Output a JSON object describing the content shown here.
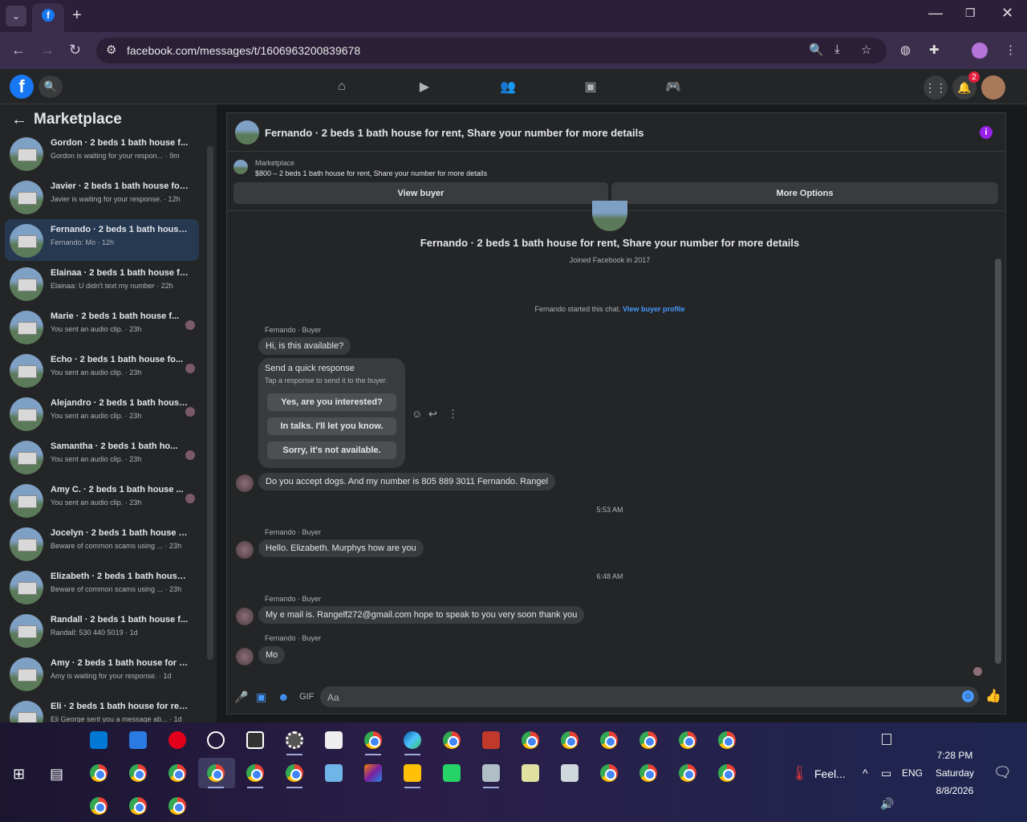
{
  "browser": {
    "url": "facebook.com/messages/t/1606963200839678",
    "new_tab": "+",
    "min": "—",
    "max": "❐",
    "close": "✕"
  },
  "fb": {
    "logo": "f",
    "notif_count": "2"
  },
  "sidebar": {
    "title": "Marketplace",
    "back": "←",
    "items": [
      {
        "title": "Gordon · 2 beds 1 bath house f...",
        "sub": "Gordon is waiting for your respon... · 9m",
        "selected": false
      },
      {
        "title": "Javier · 2 beds 1 bath house for ...",
        "sub": "Javier is waiting for your response. · 12h",
        "selected": false
      },
      {
        "title": "Fernando · 2 beds 1 bath house ...",
        "sub": "Fernando: Mo · 12h",
        "selected": true
      },
      {
        "title": "Elainaa · 2 beds 1 bath house fo...",
        "sub": "Elainaa: U didn't text my number · 22h",
        "selected": false
      },
      {
        "title": "Marie · 2 beds 1 bath house f...",
        "sub": "You sent an audio clip. · 23h",
        "selected": false
      },
      {
        "title": "Echo · 2 beds 1 bath house fo...",
        "sub": "You sent an audio clip. · 23h",
        "selected": false
      },
      {
        "title": "Alejandro · 2 beds 1 bath house...",
        "sub": "You sent an audio clip. · 23h",
        "selected": false
      },
      {
        "title": "Samantha · 2 beds 1 bath ho...",
        "sub": "You sent an audio clip. · 23h",
        "selected": false
      },
      {
        "title": "Amy C. · 2 beds 1 bath house ...",
        "sub": "You sent an audio clip. · 23h",
        "selected": false
      },
      {
        "title": "Jocelyn · 2 beds 1 bath house fo...",
        "sub": "Beware of common scams using ... · 23h",
        "selected": false
      },
      {
        "title": "Elizabeth · 2 beds 1 bath house ...",
        "sub": "Beware of common scams using ... · 23h",
        "selected": false
      },
      {
        "title": "Randall · 2 beds 1 bath house f...",
        "sub": "Randall: 530 440 5019 · 1d",
        "selected": false
      },
      {
        "title": "Amy · 2 beds 1 bath house for r...",
        "sub": "Amy is waiting for your response. · 1d",
        "selected": false
      },
      {
        "title": "Eli · 2 beds 1 bath house for ren...",
        "sub": "Eli George sent you a message ab... · 1d",
        "selected": false
      }
    ]
  },
  "chat": {
    "title": "Fernando · 2 beds 1 bath house for rent, Share your number for more details",
    "info": "i",
    "marketplace_label": "Marketplace",
    "listing": "$800 – 2 beds 1 bath house for rent, Share your number for more details",
    "view_buyer": "View buyer",
    "more_options": "More Options",
    "profile_name": "Fernando · 2 beds 1 bath house for rent, Share your number for more details",
    "joined": "Joined Facebook in 2017",
    "started_text": "Fernando started this chat.",
    "started_link": "View buyer profile",
    "sender_label": "Fernando · Buyer",
    "msg1": "Hi, is this available?",
    "quick_title": "Send a quick response",
    "quick_sub": "Tap a response to send it to the buyer.",
    "quick1": "Yes, are you interested?",
    "quick2": "In talks. I'll let you know.",
    "quick3": "Sorry, it's not available.",
    "msg2": "Do you accept dogs. And my number is 805 889 3011 Fernando. Rangel",
    "time1": "5:53 AM",
    "msg3": "Hello. Elizabeth. Murphys  how are you",
    "time2": "6:48 AM",
    "msg4": "My e mail is. Rangelf272@gmail.com  hope to speak  to you very soon thank you",
    "msg5": "Mo",
    "composer_placeholder": "Aa"
  },
  "taskbar": {
    "weather": "Feel...",
    "lang": "ENG",
    "time": "7:28 PM",
    "day": "Saturday",
    "date": "8/8/2026"
  }
}
